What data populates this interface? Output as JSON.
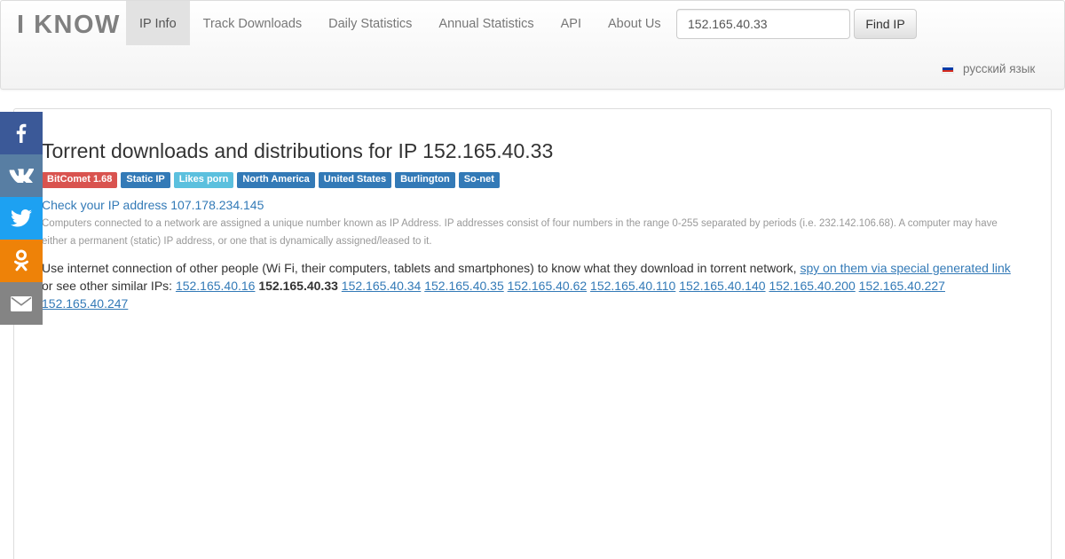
{
  "brand": "I KNOW",
  "nav": [
    {
      "label": "IP Info",
      "active": true
    },
    {
      "label": "Track Downloads",
      "active": false
    },
    {
      "label": "Daily Statistics",
      "active": false
    },
    {
      "label": "Annual Statistics",
      "active": false
    },
    {
      "label": "API",
      "active": false
    },
    {
      "label": "About Us",
      "active": false
    }
  ],
  "search": {
    "value": "152.165.40.33",
    "button_label": "Find IP"
  },
  "language": {
    "label": "русский язык",
    "flag_colors": [
      "#ffffff",
      "#0039a6",
      "#d52b1e"
    ]
  },
  "social": [
    {
      "name": "facebook-icon",
      "color": "#3b5998"
    },
    {
      "name": "vk-icon",
      "color": "#587ea3"
    },
    {
      "name": "twitter-icon",
      "color": "#1da1f2"
    },
    {
      "name": "odnoklassniki-icon",
      "color": "#ee8208"
    },
    {
      "name": "email-icon",
      "color": "#848484"
    }
  ],
  "main": {
    "title": "Torrent downloads and distributions for IP 152.165.40.33",
    "labels": [
      {
        "text": "BitComet 1.68",
        "color": "#d9534f"
      },
      {
        "text": "Static IP",
        "color": "#337ab7"
      },
      {
        "text": "Likes porn",
        "color": "#5bc0de"
      },
      {
        "text": "North America",
        "color": "#337ab7"
      },
      {
        "text": "United States",
        "color": "#337ab7"
      },
      {
        "text": "Burlington",
        "color": "#337ab7"
      },
      {
        "text": "So-net",
        "color": "#337ab7"
      }
    ],
    "check_link": "Check your IP address 107.178.234.145",
    "help_text": "Computers connected to a network are assigned a unique number known as IP Address. IP addresses consist of four numbers in the range 0-255 separated by periods (i.e. 232.142.106.68). A computer may have either a permanent (static) IP address, or one that is dynamically assigned/leased to it.",
    "para_text_1": "Use internet connection of other people (Wi Fi, their computers, tablets and smartphones) to know what they download in torrent network, ",
    "spy_link": "spy on them via special generated link",
    "para_text_2": " or see other similar IPs: ",
    "similar_ips": [
      {
        "ip": "152.165.40.16",
        "current": false
      },
      {
        "ip": "152.165.40.33",
        "current": true
      },
      {
        "ip": "152.165.40.34",
        "current": false
      },
      {
        "ip": "152.165.40.35",
        "current": false
      },
      {
        "ip": "152.165.40.62",
        "current": false
      },
      {
        "ip": "152.165.40.110",
        "current": false
      },
      {
        "ip": "152.165.40.140",
        "current": false
      },
      {
        "ip": "152.165.40.200",
        "current": false
      },
      {
        "ip": "152.165.40.227",
        "current": false
      },
      {
        "ip": "152.165.40.247",
        "current": false
      }
    ]
  }
}
